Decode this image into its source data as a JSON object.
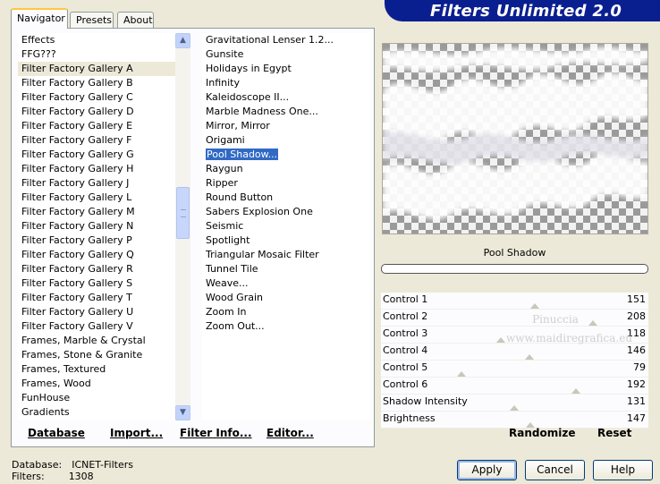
{
  "banner": {
    "title": "Filters Unlimited 2.0"
  },
  "tabs": [
    {
      "label": "Navigator",
      "active": true
    },
    {
      "label": "Presets",
      "active": false
    },
    {
      "label": "About",
      "active": false
    }
  ],
  "categories": {
    "items": [
      "Effects",
      "FFG???",
      "Filter Factory Gallery A",
      "Filter Factory Gallery B",
      "Filter Factory Gallery C",
      "Filter Factory Gallery D",
      "Filter Factory Gallery E",
      "Filter Factory Gallery F",
      "Filter Factory Gallery G",
      "Filter Factory Gallery H",
      "Filter Factory Gallery J",
      "Filter Factory Gallery L",
      "Filter Factory Gallery M",
      "Filter Factory Gallery N",
      "Filter Factory Gallery P",
      "Filter Factory Gallery Q",
      "Filter Factory Gallery R",
      "Filter Factory Gallery S",
      "Filter Factory Gallery T",
      "Filter Factory Gallery U",
      "Filter Factory Gallery V",
      "Frames, Marble & Crystal",
      "Frames, Stone & Granite",
      "Frames, Textured",
      "Frames, Wood",
      "FunHouse",
      "Gradients"
    ],
    "selected_index": 2
  },
  "filters": {
    "items": [
      "Gravitational Lenser 1.2...",
      "Gunsite",
      "Holidays in Egypt",
      "Infinity",
      "Kaleidoscope II...",
      "Marble Madness One...",
      "Mirror, Mirror",
      "Origami",
      "Pool Shadow...",
      "Raygun",
      "Ripper",
      "Round Button",
      "Sabers Explosion One",
      "Seismic",
      "Spotlight",
      "Triangular Mosaic Filter",
      "Tunnel Tile",
      "Weave...",
      "Wood Grain",
      "Zoom In",
      "Zoom Out..."
    ],
    "selected_index": 8
  },
  "bottom_left_buttons": {
    "database": "Database",
    "import": "Import...",
    "filter_info": "Filter Info...",
    "editor": "Editor..."
  },
  "filter_name": "Pool Shadow",
  "controls": [
    {
      "label": "Control 1",
      "value": "151",
      "level": 151
    },
    {
      "label": "Control 2",
      "value": "208",
      "level": 208
    },
    {
      "label": "Control 3",
      "value": "118",
      "level": 118
    },
    {
      "label": "Control 4",
      "value": "146",
      "level": 146
    },
    {
      "label": "Control 5",
      "value": "79",
      "level": 79
    },
    {
      "label": "Control 6",
      "value": "192",
      "level": 192
    },
    {
      "label": "Shadow Intensity",
      "value": "131",
      "level": 131
    },
    {
      "label": "Brightness",
      "value": "147",
      "level": 147
    }
  ],
  "watermark": {
    "line1": "Pinuccia",
    "line2": "www.maidiregrafica.eu"
  },
  "right_buttons": {
    "randomize": "Randomize",
    "reset": "Reset"
  },
  "status": {
    "database_label": "Database:",
    "database_value": "ICNET-Filters",
    "filters_label": "Filters:",
    "filters_value": "1308"
  },
  "dialog_buttons": {
    "apply": "Apply",
    "cancel": "Cancel",
    "help": "Help"
  }
}
